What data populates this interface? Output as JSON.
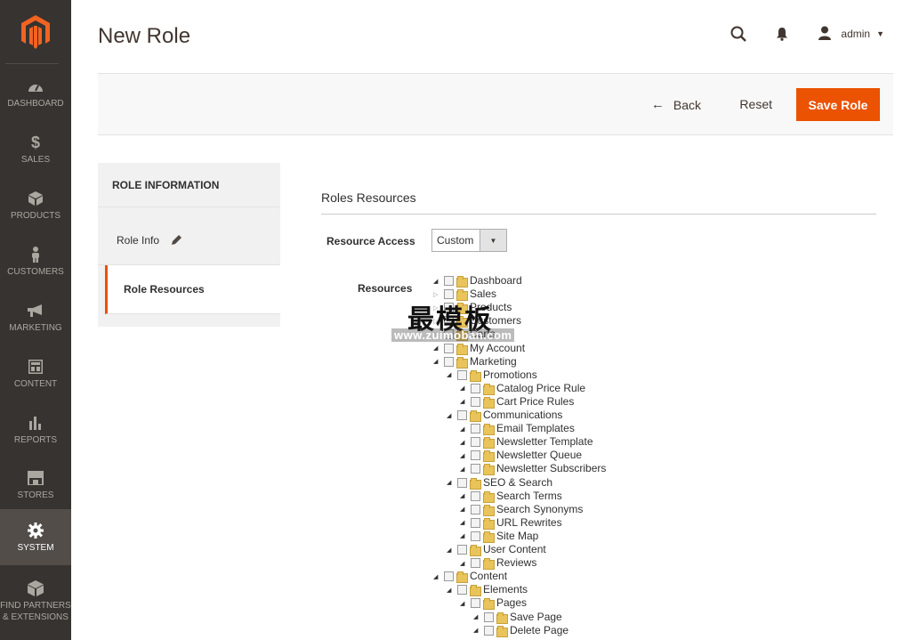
{
  "menu": {
    "items": [
      {
        "label": "DASHBOARD",
        "icon": "dashboard-icon"
      },
      {
        "label": "SALES",
        "icon": "dollar-icon"
      },
      {
        "label": "PRODUCTS",
        "icon": "box-icon"
      },
      {
        "label": "CUSTOMERS",
        "icon": "person-icon"
      },
      {
        "label": "MARKETING",
        "icon": "megaphone-icon"
      },
      {
        "label": "CONTENT",
        "icon": "layout-icon"
      },
      {
        "label": "REPORTS",
        "icon": "bar-chart-icon"
      },
      {
        "label": "STORES",
        "icon": "store-icon"
      },
      {
        "label": "SYSTEM",
        "icon": "gear-icon",
        "active": true
      },
      {
        "label": "FIND PARTNERS & EXTENSIONS",
        "icon": "cube-icon"
      }
    ]
  },
  "header": {
    "title": "New Role",
    "user": "admin"
  },
  "actions": {
    "back": "Back",
    "reset": "Reset",
    "save": "Save Role"
  },
  "sidebar": {
    "title": "ROLE INFORMATION",
    "tabs": [
      {
        "label": "Role Info"
      },
      {
        "label": "Role Resources",
        "active": true
      }
    ]
  },
  "main": {
    "section_title": "Roles Resources",
    "resource_access_label": "Resource Access",
    "resource_access_value": "Custom",
    "resources_label": "Resources"
  },
  "tree": [
    {
      "label": "Dashboard",
      "level": 0,
      "toggle": "open"
    },
    {
      "label": "Sales",
      "level": 0,
      "toggle": "closed"
    },
    {
      "label": "Products",
      "level": 0,
      "toggle": "closed"
    },
    {
      "label": "Customers",
      "level": 0,
      "toggle": "closed"
    },
    {
      "label": "Carts",
      "level": 0,
      "toggle": "closed"
    },
    {
      "label": "My Account",
      "level": 0,
      "toggle": "open"
    },
    {
      "label": "Marketing",
      "level": 0,
      "toggle": "open"
    },
    {
      "label": "Promotions",
      "level": 1,
      "toggle": "open"
    },
    {
      "label": "Catalog Price Rule",
      "level": 2,
      "toggle": "open"
    },
    {
      "label": "Cart Price Rules",
      "level": 2,
      "toggle": "open"
    },
    {
      "label": "Communications",
      "level": 1,
      "toggle": "open"
    },
    {
      "label": "Email Templates",
      "level": 2,
      "toggle": "open"
    },
    {
      "label": "Newsletter Template",
      "level": 2,
      "toggle": "open"
    },
    {
      "label": "Newsletter Queue",
      "level": 2,
      "toggle": "open"
    },
    {
      "label": "Newsletter Subscribers",
      "level": 2,
      "toggle": "open"
    },
    {
      "label": "SEO & Search",
      "level": 1,
      "toggle": "open"
    },
    {
      "label": "Search Terms",
      "level": 2,
      "toggle": "open"
    },
    {
      "label": "Search Synonyms",
      "level": 2,
      "toggle": "open"
    },
    {
      "label": "URL Rewrites",
      "level": 2,
      "toggle": "open"
    },
    {
      "label": "Site Map",
      "level": 2,
      "toggle": "open"
    },
    {
      "label": "User Content",
      "level": 1,
      "toggle": "open"
    },
    {
      "label": "Reviews",
      "level": 2,
      "toggle": "open"
    },
    {
      "label": "Content",
      "level": 0,
      "toggle": "open"
    },
    {
      "label": "Elements",
      "level": 1,
      "toggle": "open"
    },
    {
      "label": "Pages",
      "level": 2,
      "toggle": "open"
    },
    {
      "label": "Save Page",
      "level": 3,
      "toggle": "open"
    },
    {
      "label": "Delete Page",
      "level": 3,
      "toggle": "open"
    }
  ],
  "watermark": {
    "text": "最模板",
    "url": "www.zuimoban.com"
  }
}
